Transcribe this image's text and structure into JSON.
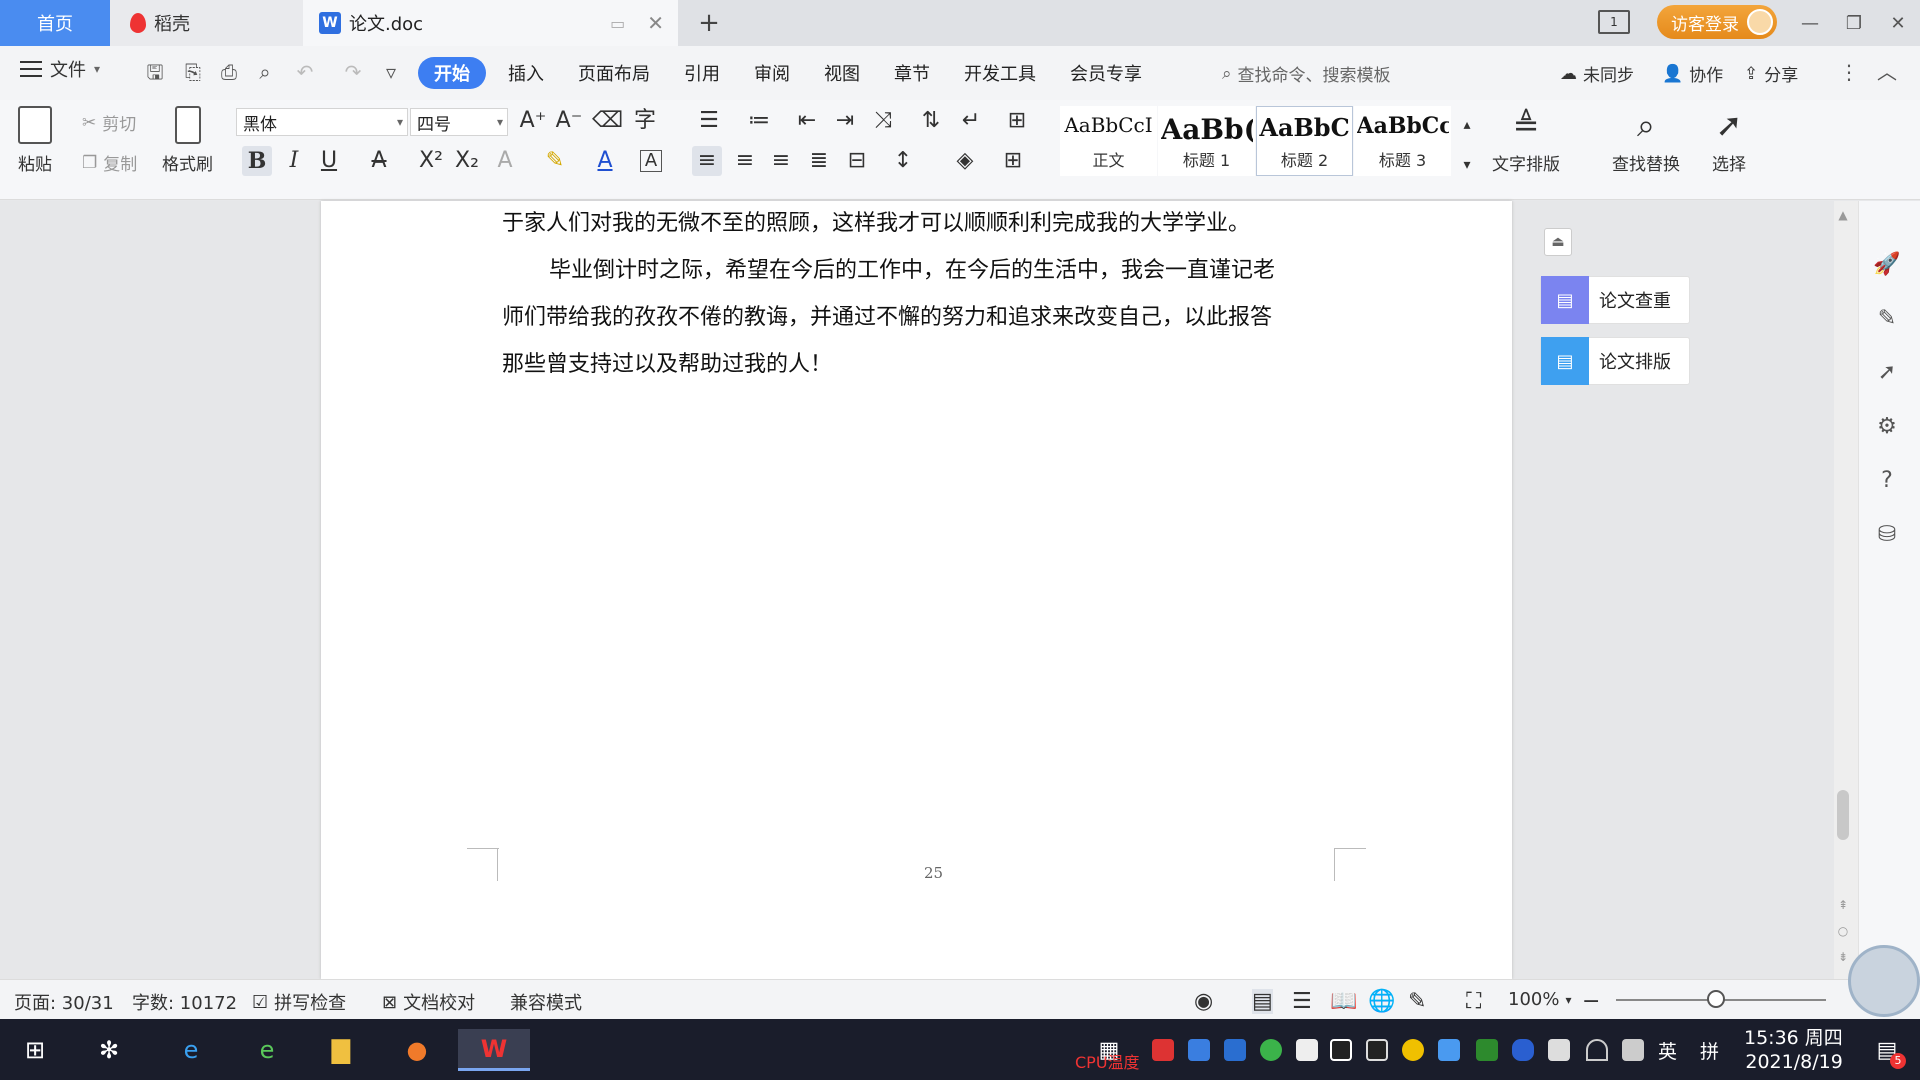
{
  "tabs": {
    "home": "首页",
    "daoke": "稻壳",
    "document": "论文.doc",
    "new_tab": "+"
  },
  "header": {
    "login": "访客登录",
    "layout_indicator": "1"
  },
  "menu": {
    "file": "文件",
    "items": [
      "开始",
      "插入",
      "页面布局",
      "引用",
      "审阅",
      "视图",
      "章节",
      "开发工具",
      "会员专享"
    ],
    "active": "开始",
    "search_placeholder": "查找命令、搜索模板",
    "unsync": "未同步",
    "collab": "协作",
    "share": "分享"
  },
  "ribbon": {
    "paste": "粘贴",
    "cut": "剪切",
    "copy": "复制",
    "format_painter": "格式刷",
    "font_name": "黑体",
    "font_size": "四号",
    "styles": [
      {
        "preview": "AaBbCcI",
        "label": "正文"
      },
      {
        "preview": "AaBb(",
        "label": "标题 1"
      },
      {
        "preview": "AaBbC",
        "label": "标题 2"
      },
      {
        "preview": "AaBbCcl",
        "label": "标题 3"
      }
    ],
    "text_layout": "文字排版",
    "find_replace": "查找替换",
    "select": "选择"
  },
  "document": {
    "lines": [
      "于家人们对我的无微不至的照顾，这样我才可以顺顺利利完成我的大学学业。",
      "毕业倒计时之际，希望在今后的工作中，在今后的生活中，我会一直谨记老",
      "师们带给我的孜孜不倦的教诲，并通过不懈的努力和追求来改变自己，以此报答",
      "那些曾支持过以及帮助过我的人！"
    ],
    "page_number": "25"
  },
  "panel": {
    "check": "论文查重",
    "layout": "论文排版"
  },
  "status": {
    "page": "页面: 30/31",
    "words": "字数: 10172",
    "spell": "拼写检查",
    "proof": "文档校对",
    "compat": "兼容模式",
    "zoom": "100%"
  },
  "taskbar": {
    "cpu_label": "CPU温度",
    "lang": "英",
    "ime": "拼",
    "time": "15:36 周四",
    "date": "2021/8/19",
    "notify_count": "5"
  },
  "colors": {
    "accent": "#3d7ef2",
    "home_tab": "#4a8cf0",
    "login": "#e58a1b"
  }
}
